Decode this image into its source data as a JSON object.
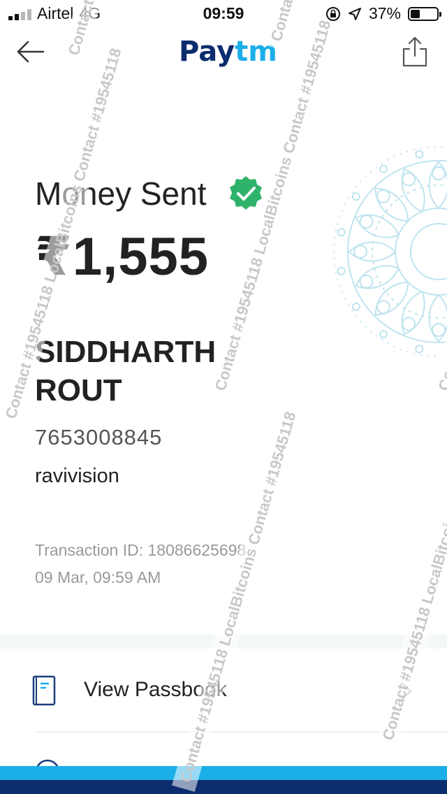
{
  "status_bar": {
    "carrier": "Airtel",
    "network": "4G",
    "time": "09:59",
    "battery": "37%",
    "battery_level": 0.37
  },
  "header": {
    "logo_pay": "Pay",
    "logo_tm": "tm",
    "back_icon": "arrow-left-icon",
    "share_icon": "share-icon"
  },
  "receipt": {
    "title": "Money Sent",
    "amount": "₹1,555",
    "name": "SIDDHARTH ROUT",
    "phone": "7653008845",
    "handle": "ravivision",
    "transaction_id": "Transaction ID: 18086625698",
    "date": "09 Mar, 09:59 AM"
  },
  "actions": {
    "view_passbook": "View Passbook"
  },
  "watermark": {
    "text": "Contact #19545118",
    "brand": "LocalBitcoins"
  },
  "colors": {
    "paytm_dark": "#0b2d6e",
    "paytm_light": "#1baee8",
    "verified_green": "#2fb36b"
  }
}
